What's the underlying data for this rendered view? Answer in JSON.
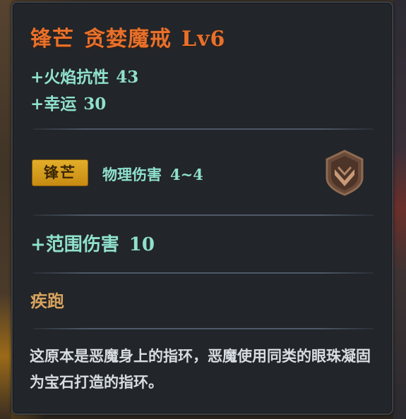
{
  "item": {
    "prefix": "锋芒",
    "name": "贪婪魔戒",
    "level": "Lv6",
    "stats": [
      {
        "label": "+火焰抗性",
        "value": "43"
      },
      {
        "label": "+幸运",
        "value": "30"
      }
    ],
    "affix_badge": "锋芒",
    "damage_label": "物理伤害",
    "damage_value": "4~4",
    "emblem_icon": "bronze-shield-chevron",
    "extra_stat_label": "+范围伤害",
    "extra_stat_value": "10",
    "skill_name": "疾跑",
    "description": "这原本是恶魔身上的指环，恶魔使用同类的眼珠凝固为宝石打造的指环。"
  },
  "colors": {
    "title": "#e8702a",
    "stat": "#8fe0cd",
    "skill": "#d7a35d",
    "description": "#d7dde2",
    "badge": "#d9a021",
    "panel": "#222529"
  }
}
